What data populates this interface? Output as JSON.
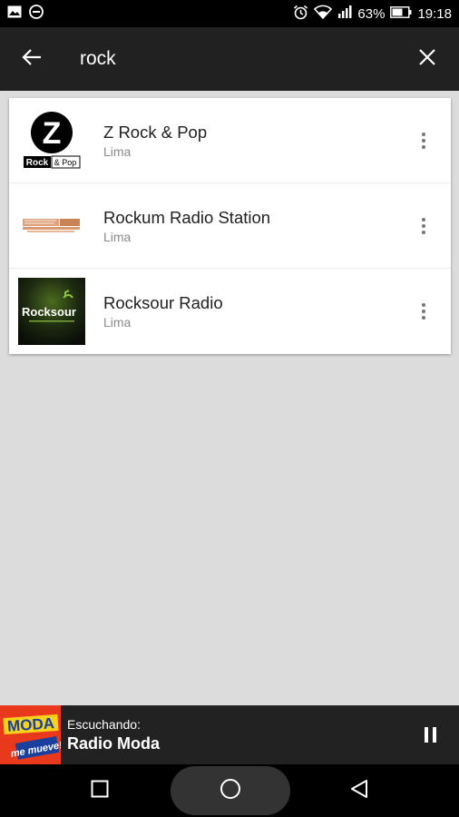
{
  "status_bar": {
    "battery": "63%",
    "time": "19:18",
    "icons": [
      "image-notification-icon",
      "do-not-disturb-icon",
      "alarm-icon",
      "wifi-icon",
      "signal-icon",
      "battery-icon"
    ]
  },
  "search": {
    "query": "rock",
    "back_icon": "arrow-back-icon",
    "clear_icon": "close-icon"
  },
  "results": [
    {
      "title": "Z Rock & Pop",
      "subtitle": "Lima",
      "logo": "z-rock-pop-logo"
    },
    {
      "title": "Rockum Radio Station",
      "subtitle": "Lima",
      "logo": "rockum-logo"
    },
    {
      "title": "Rocksour Radio",
      "subtitle": "Lima",
      "logo": "rocksour-logo"
    }
  ],
  "logo_text": {
    "zrock_letter": "Z",
    "zrock_rock": "Rock",
    "zrock_pop": "& Pop",
    "rocksour": "Rocksour",
    "moda_top": "MODA",
    "moda_bottom": "me mueve!"
  },
  "now_playing": {
    "label": "Escuchando:",
    "station": "Radio Moda",
    "logo": "radio-moda-logo",
    "control_icon": "pause-icon"
  },
  "nav": {
    "icons": [
      "recent-apps-icon",
      "home-icon",
      "back-triangle-icon"
    ]
  },
  "colors": {
    "toolbar": "#212121",
    "background": "#dcdcdc",
    "now_playing_bar": "#222222",
    "moda_red": "#e8391c"
  }
}
